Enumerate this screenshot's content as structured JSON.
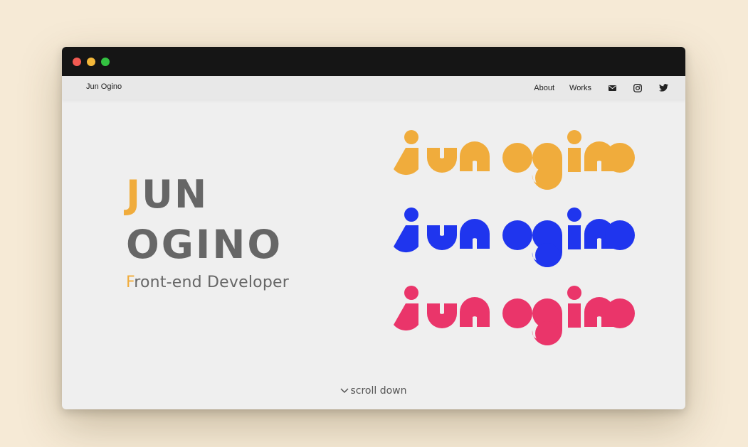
{
  "window": {
    "buttons": [
      "close",
      "minimize",
      "maximize"
    ]
  },
  "navbar": {
    "brand": "Jun Ogino",
    "links": [
      {
        "label": "About"
      },
      {
        "label": "Works"
      }
    ],
    "icons": [
      "mail-icon",
      "instagram-icon",
      "twitter-icon"
    ]
  },
  "hero": {
    "name_line1_accent": "J",
    "name_line1_rest": "UN",
    "name_line2": "OGINO",
    "role_accent": "F",
    "role_rest": "ront-end Developer"
  },
  "logos": {
    "colors": [
      "#f0ac3c",
      "#1f35ee",
      "#ea356a"
    ]
  },
  "scroll": {
    "label": "scroll down"
  }
}
